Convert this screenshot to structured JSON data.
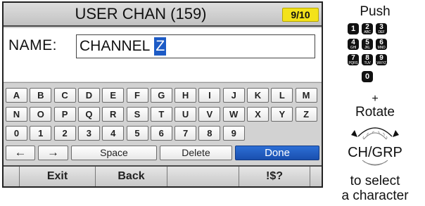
{
  "screen": {
    "title": "USER CHAN (159)",
    "page_indicator": "9/10",
    "name_label": "NAME:",
    "name_value": "CHANNEL",
    "cursor_char": "Z"
  },
  "keyboard": {
    "row1": [
      "A",
      "B",
      "C",
      "D",
      "E",
      "F",
      "G",
      "H",
      "I",
      "J",
      "K",
      "L",
      "M"
    ],
    "row2": [
      "N",
      "O",
      "P",
      "Q",
      "R",
      "S",
      "T",
      "U",
      "V",
      "W",
      "X",
      "Y",
      "Z"
    ],
    "row3": [
      "0",
      "1",
      "2",
      "3",
      "4",
      "5",
      "6",
      "7",
      "8",
      "9"
    ],
    "left_arrow": "←",
    "right_arrow": "→",
    "space": "Space",
    "delete": "Delete",
    "done": "Done"
  },
  "softkeys": [
    "Exit",
    "Back",
    "",
    "!$?"
  ],
  "instructions": {
    "push": "Push",
    "plus": "+",
    "rotate": "Rotate",
    "dial_label": "CH/GRP",
    "line1": "to select",
    "line2": "a character",
    "keypad": [
      {
        "num": "1",
        "letters": ""
      },
      {
        "num": "2",
        "letters": "ABC"
      },
      {
        "num": "3",
        "letters": "DEF"
      },
      {
        "num": "4",
        "letters": "GHI"
      },
      {
        "num": "5",
        "letters": "JKL"
      },
      {
        "num": "6",
        "letters": "MNO"
      },
      {
        "num": "7",
        "letters": "PQRS"
      },
      {
        "num": "8",
        "letters": "TUV"
      },
      {
        "num": "9",
        "letters": "WXYZ"
      },
      {
        "num": "0",
        "letters": ""
      }
    ]
  },
  "colors": {
    "accent": "#1d5bc6",
    "badge": "#f3e21a",
    "screen_bg": "#d4d4d4"
  }
}
